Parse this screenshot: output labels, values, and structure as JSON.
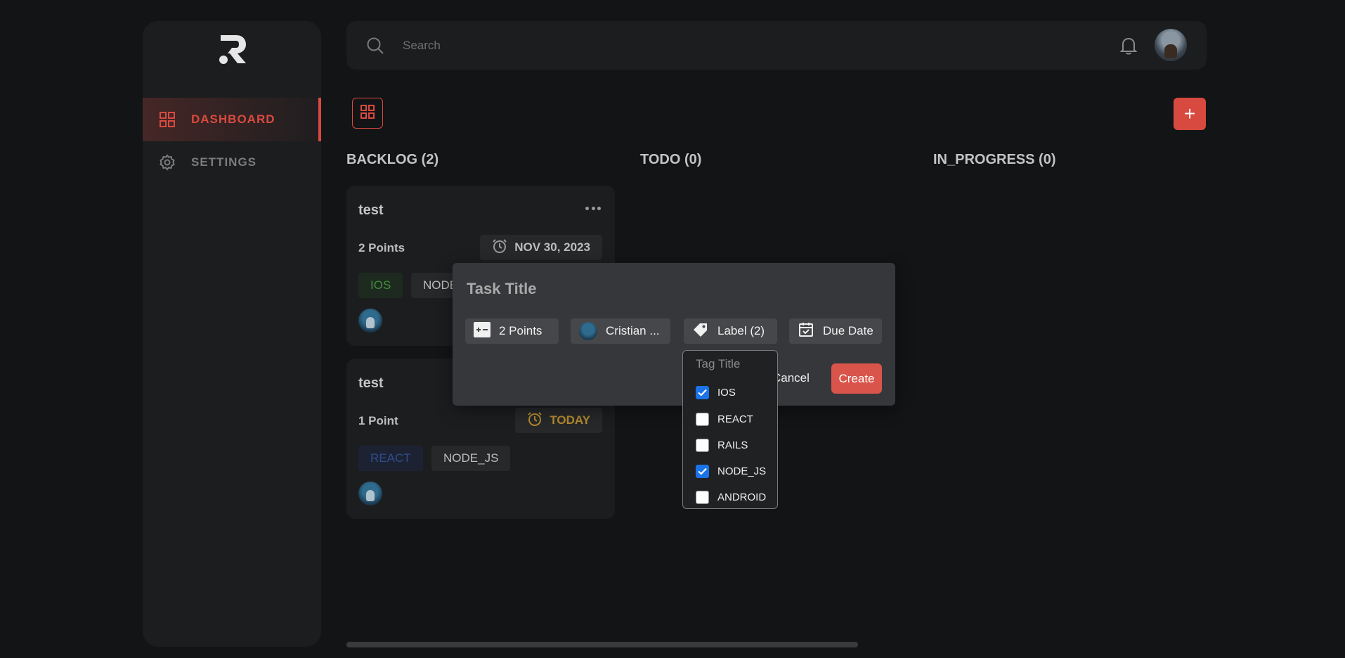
{
  "sidebar": {
    "items": [
      {
        "label": "DASHBOARD",
        "icon": "dashboard-grid-icon",
        "active": true
      },
      {
        "label": "SETTINGS",
        "icon": "gear-icon",
        "active": false
      }
    ]
  },
  "topbar": {
    "search_placeholder": "Search",
    "search_value": ""
  },
  "board": {
    "add_label": "+",
    "columns": [
      {
        "title": "BACKLOG (2)"
      },
      {
        "title": "TODO (0)"
      },
      {
        "title": "IN_PROGRESS (0)"
      }
    ],
    "cards": [
      {
        "title": "test",
        "points": "2 Points",
        "date": "NOV 30, 2023",
        "tags": [
          "IOS",
          "NODE"
        ]
      },
      {
        "title": "test",
        "points": "1 Point",
        "date": "TODAY",
        "tags": [
          "REACT",
          "NODE_JS"
        ]
      }
    ]
  },
  "modal": {
    "title_placeholder": "Task Title",
    "points_label": "2 Points",
    "assignee_label": "Cristian ...",
    "label_label": "Label (2)",
    "due_label": "Due Date",
    "cancel_label": "Cancel",
    "create_label": "Create"
  },
  "dropdown": {
    "title": "Tag Title",
    "options": [
      {
        "label": "IOS",
        "checked": true
      },
      {
        "label": "REACT",
        "checked": false
      },
      {
        "label": "RAILS",
        "checked": false
      },
      {
        "label": "NODE_JS",
        "checked": true
      },
      {
        "label": "ANDROID",
        "checked": false
      }
    ]
  },
  "colors": {
    "accent": "#d84a3f",
    "background": "#131416",
    "panel": "#1c1d1f",
    "modal": "#36373a",
    "checkbox_checked": "#1a73e8"
  }
}
